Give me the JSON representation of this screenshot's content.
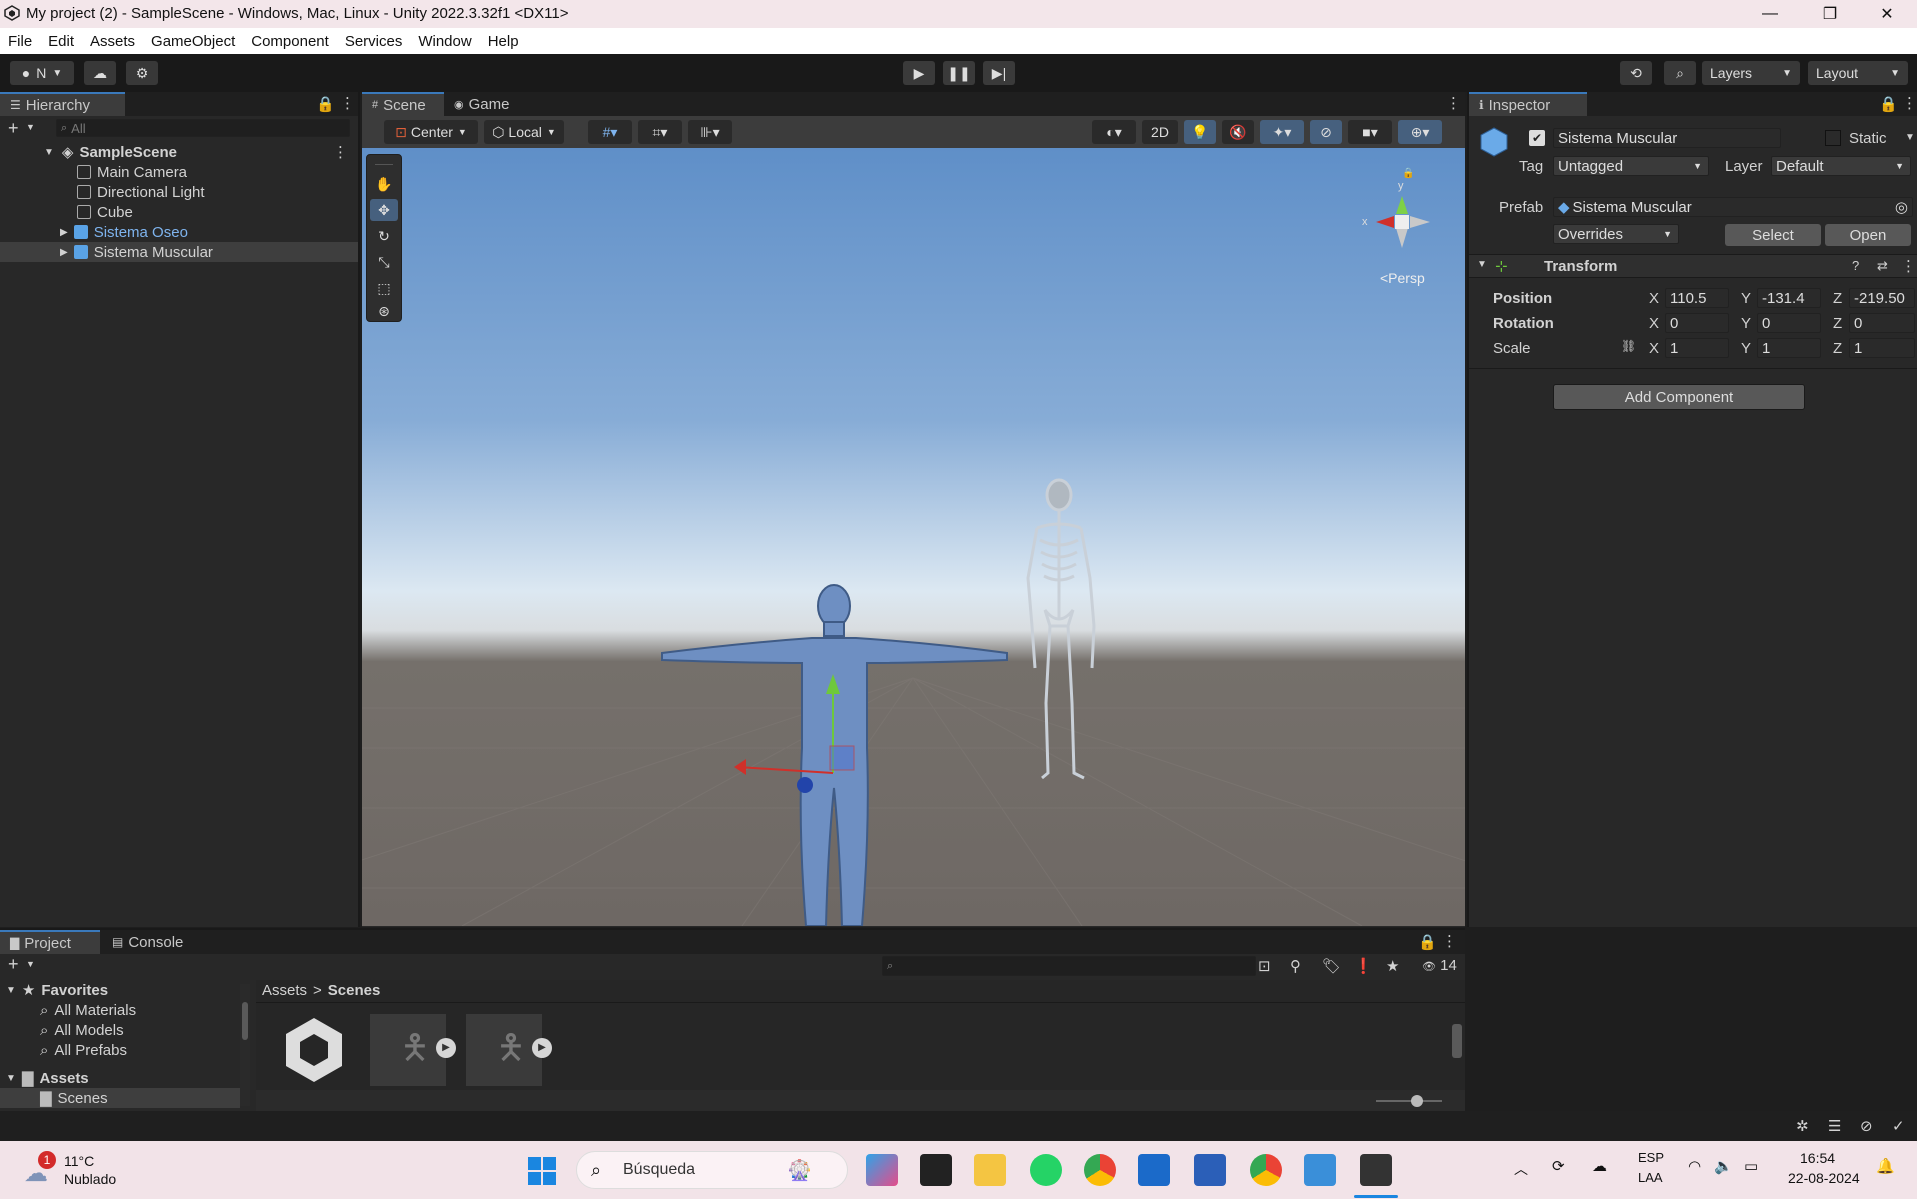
{
  "window": {
    "title": "My project (2) - SampleScene - Windows, Mac, Linux - Unity 2022.3.32f1 <DX11>",
    "controls": [
      "—",
      "❐",
      "✕"
    ]
  },
  "menu": [
    "File",
    "Edit",
    "Assets",
    "GameObject",
    "Component",
    "Services",
    "Window",
    "Help"
  ],
  "toolbar": {
    "account": "N",
    "layers_label": "Layers",
    "layout_label": "Layout"
  },
  "hierarchy": {
    "tab": "Hierarchy",
    "search_placeholder": "All",
    "scene": "SampleScene",
    "items": [
      {
        "label": "Main Camera",
        "type": "object"
      },
      {
        "label": "Directional Light",
        "type": "object"
      },
      {
        "label": "Cube",
        "type": "object"
      },
      {
        "label": "Sistema Oseo",
        "type": "prefab"
      },
      {
        "label": "Sistema Muscular",
        "type": "prefab"
      }
    ]
  },
  "scene": {
    "tabs": [
      "Scene",
      "Game"
    ],
    "pivot": "Center",
    "space": "Local",
    "mode_2d": "2D",
    "persp": "<Persp",
    "gizmo_x": "x",
    "gizmo_y": "y"
  },
  "inspector": {
    "tab": "Inspector",
    "object_name": "Sistema Muscular",
    "static_label": "Static",
    "tag_label": "Tag",
    "tag_value": "Untagged",
    "layer_label": "Layer",
    "layer_value": "Default",
    "prefab_label": "Prefab",
    "prefab_value": "Sistema Muscular",
    "overrides": "Overrides",
    "select_btn": "Select",
    "open_btn": "Open",
    "transform_title": "Transform",
    "position_label": "Position",
    "rotation_label": "Rotation",
    "scale_label": "Scale",
    "axis_x": "X",
    "axis_y": "Y",
    "axis_z": "Z",
    "position": {
      "x": "110.5",
      "y": "-131.4",
      "z": "-219.50"
    },
    "rotation": {
      "x": "0",
      "y": "0",
      "z": "0"
    },
    "scale": {
      "x": "1",
      "y": "1",
      "z": "1"
    },
    "add_component": "Add Component"
  },
  "project": {
    "tabs": [
      "Project",
      "Console"
    ],
    "favorites": "Favorites",
    "fav_items": [
      "All Materials",
      "All Models",
      "All Prefabs"
    ],
    "assets": "Assets",
    "assets_children": [
      "Scenes"
    ],
    "breadcrumb": [
      "Assets",
      "Scenes"
    ],
    "hidden_count": "14"
  },
  "taskbar": {
    "weather_temp": "11°C",
    "weather_desc": "Nublado",
    "weather_badge": "1",
    "search_placeholder": "Búsqueda",
    "lang_top": "ESP",
    "lang_bottom": "LAA",
    "time": "16:54",
    "date": "22-08-2024"
  },
  "colors": {
    "accent": "#3a79bb",
    "selection": "#3e3e3e",
    "prefab_blue": "#7fb4ee"
  }
}
